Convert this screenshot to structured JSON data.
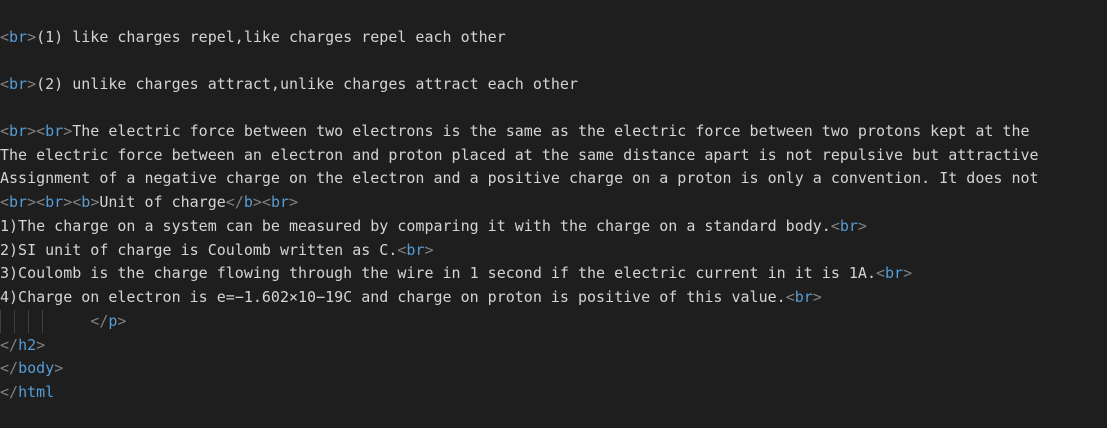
{
  "editor": {
    "lines": [
      {
        "segments": [
          {
            "t": "tag",
            "v": "<"
          },
          {
            "t": "tag-name",
            "v": "br"
          },
          {
            "t": "tag",
            "v": ">"
          },
          {
            "t": "text",
            "v": "(1) like charges repel,like charges repel each other"
          }
        ]
      },
      {
        "segments": [
          {
            "t": "tag",
            "v": "<"
          },
          {
            "t": "tag-name",
            "v": "br"
          },
          {
            "t": "tag",
            "v": ">"
          },
          {
            "t": "text",
            "v": "(2) unlike charges attract,unlike charges attract each other"
          }
        ]
      },
      {
        "segments": [
          {
            "t": "tag",
            "v": "<"
          },
          {
            "t": "tag-name",
            "v": "br"
          },
          {
            "t": "tag",
            "v": ">"
          },
          {
            "t": "tag",
            "v": "<"
          },
          {
            "t": "tag-name",
            "v": "br"
          },
          {
            "t": "tag",
            "v": ">"
          },
          {
            "t": "text",
            "v": "The electric force between two electrons is the same as the electric force between two protons kept at the"
          }
        ]
      },
      {
        "segments": [
          {
            "t": "text",
            "v": "The electric force between an electron and proton placed at the same distance apart is not repulsive but attractive"
          }
        ]
      },
      {
        "segments": [
          {
            "t": "text",
            "v": "Assignment of a negative charge on the electron and a positive charge on a proton is only a convention. It does not"
          }
        ]
      },
      {
        "segments": [
          {
            "t": "tag",
            "v": "<"
          },
          {
            "t": "tag-name",
            "v": "br"
          },
          {
            "t": "tag",
            "v": ">"
          },
          {
            "t": "tag",
            "v": "<"
          },
          {
            "t": "tag-name",
            "v": "br"
          },
          {
            "t": "tag",
            "v": ">"
          },
          {
            "t": "tag",
            "v": "<"
          },
          {
            "t": "tag-name",
            "v": "b"
          },
          {
            "t": "tag",
            "v": ">"
          },
          {
            "t": "text",
            "v": "Unit of charge"
          },
          {
            "t": "tag",
            "v": "</"
          },
          {
            "t": "tag-name",
            "v": "b"
          },
          {
            "t": "tag",
            "v": ">"
          },
          {
            "t": "tag",
            "v": "<"
          },
          {
            "t": "tag-name",
            "v": "br"
          },
          {
            "t": "tag",
            "v": ">"
          }
        ]
      },
      {
        "segments": [
          {
            "t": "text",
            "v": "1)The charge on a system can be measured by comparing it with the charge on a standard body."
          },
          {
            "t": "tag",
            "v": "<"
          },
          {
            "t": "tag-name",
            "v": "br"
          },
          {
            "t": "tag",
            "v": ">"
          }
        ]
      },
      {
        "segments": [
          {
            "t": "text",
            "v": "2)SI unit of charge is Coulomb written as C."
          },
          {
            "t": "tag",
            "v": "<"
          },
          {
            "t": "tag-name",
            "v": "br"
          },
          {
            "t": "tag",
            "v": ">"
          }
        ]
      },
      {
        "segments": [
          {
            "t": "text",
            "v": "3)Coulomb is the charge flowing through the wire in 1 second if the electric current in it is 1A."
          },
          {
            "t": "tag",
            "v": "<"
          },
          {
            "t": "tag-name",
            "v": "br"
          },
          {
            "t": "tag",
            "v": ">"
          }
        ]
      },
      {
        "segments": [
          {
            "t": "text",
            "v": "4)Charge on electron is e=−1.602×10−19C and charge on proton is positive of this value."
          },
          {
            "t": "tag",
            "v": "<"
          },
          {
            "t": "tag-name",
            "v": "br"
          },
          {
            "t": "tag",
            "v": ">"
          }
        ]
      },
      {
        "indent_guides": 4,
        "segments": [
          {
            "t": "text",
            "v": "          "
          },
          {
            "t": "tag",
            "v": "</"
          },
          {
            "t": "tag-name",
            "v": "p"
          },
          {
            "t": "tag",
            "v": ">"
          }
        ]
      },
      {
        "segments": [
          {
            "t": "tag",
            "v": "</"
          },
          {
            "t": "tag-name",
            "v": "h2"
          },
          {
            "t": "tag",
            "v": ">"
          }
        ]
      },
      {
        "segments": [
          {
            "t": "tag",
            "v": "</"
          },
          {
            "t": "tag-name",
            "v": "body"
          },
          {
            "t": "tag",
            "v": ">"
          }
        ]
      },
      {
        "segments": [
          {
            "t": "tag",
            "v": "</"
          },
          {
            "t": "tag-name",
            "v": "html"
          }
        ]
      }
    ]
  }
}
